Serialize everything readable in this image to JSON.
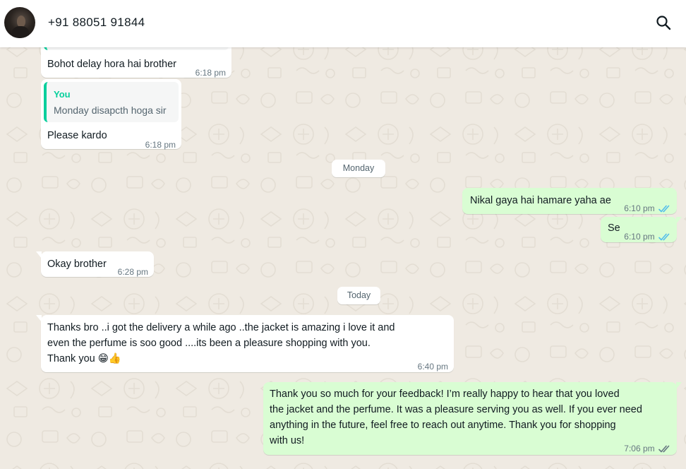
{
  "header": {
    "contact_name": "+91 88051 91844",
    "search_icon": "search-icon"
  },
  "messages": [
    {
      "text": "Bohot delay hora hai brother",
      "time": "6:18 pm"
    },
    {
      "quote_author": "You",
      "quote_text": "Monday disapcth hoga sir",
      "text": "Please kardo",
      "time": "6:18 pm"
    },
    {
      "date": "Monday"
    },
    {
      "text": "Nikal gaya hai hamare yaha ae",
      "time": "6:10 pm",
      "status": "read"
    },
    {
      "text": "Se",
      "time": "6:10 pm",
      "status": "read"
    },
    {
      "text": "Okay brother",
      "time": "6:28 pm"
    },
    {
      "date": "Today"
    },
    {
      "lines": [
        "Thanks bro ..i got the delivery a while ago ..the jacket is amazing i love it and",
        "even the perfume is soo good ....its been a pleasure shopping with you.",
        "Thank you 😁👍"
      ],
      "time": "6:40 pm"
    },
    {
      "lines": [
        "Thank you so much for your feedback! I’m really happy to hear that you loved",
        "the jacket and the perfume. It was a pleasure serving you as well. If you ever need",
        "anything in the future, feel free to reach out anytime. Thank you for shopping",
        "with us!"
      ],
      "time": "7:06 pm",
      "status": "delivered"
    }
  ],
  "colors": {
    "chat_bg": "#efeae2",
    "incoming_bubble": "#ffffff",
    "outgoing_bubble": "#d9fdd3",
    "read_tick": "#53bdeb",
    "delivered_tick": "#667781",
    "quote_accent": "#06cf9c"
  }
}
